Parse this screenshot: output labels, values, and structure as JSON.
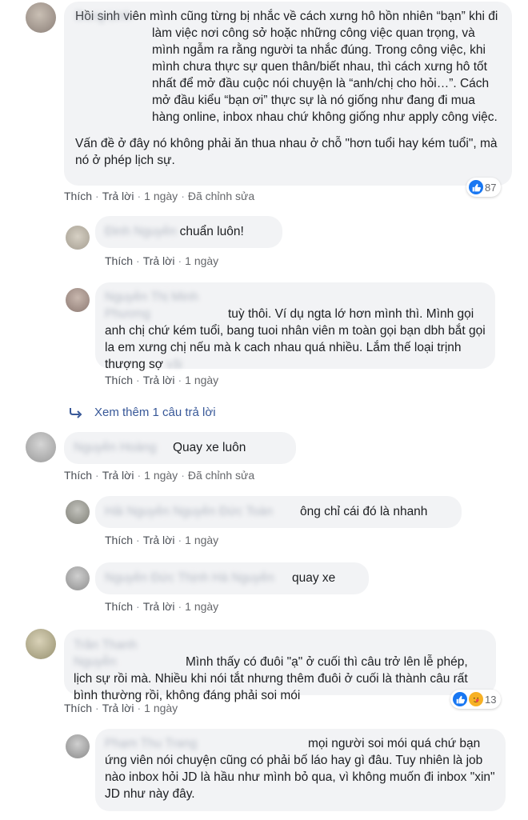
{
  "actions": {
    "like": "Thích",
    "reply": "Trả lời",
    "edited": "Đã chỉnh sửa",
    "dot": "·"
  },
  "comments": [
    {
      "name": "Dung Linh",
      "text": "Hồi sinh viên mình cũng từng bị nhắc về cách xưng hô hồn nhiên “bạn” khi đi làm việc nơi công sở hoặc những công việc quan trọng, và mình ngẫm ra rằng người ta nhắc đúng. Trong công việc, khi mình chưa thực sự quen thân/biết nhau, thì cách xưng hô tốt nhất để mở đầu cuộc nói chuyện là “anh/chị cho hỏi…”. Cách mở đầu kiểu “bạn ơi” thực sự là nó giống như đang đi mua hàng online, inbox nhau chứ không giống như apply công việc.",
      "text2": "Vấn đề ở đây nó không phải ăn thua nhau ở chỗ \"hơn tuổi hay kém tuổi\", mà nó ở phép lịch sự.",
      "time": "1 ngày",
      "reactions": "87"
    },
    {
      "name": "Đinh Nguyễn",
      "text": "chuẩn luôn!",
      "time": "1 ngày"
    },
    {
      "name": "Nguyễn Thị Minh Phương",
      "text": "tuỳ thôi. Ví dụ ngta lớ hơn mình thì. Mình gọi anh chị chứ kém tuổi, bang tuoi nhân viên m toàn gọi bạn dbh bắt gọi la em xưng chị nếu mà k cach nhau quá nhiều. Lắm thế loại trịnh thượng sợ",
      "tail": "vãi",
      "time": "1 ngày"
    },
    {
      "more": "Xem thêm 1 câu trả lời"
    },
    {
      "name": "Nguyễn Hoàng",
      "text": "Quay xe luôn",
      "time": "1 ngày"
    },
    {
      "name": "Hải Nguyễn Nguyễn Đức Toàn",
      "text": "ông chỉ cái đó là nhanh",
      "time": "1 ngày"
    },
    {
      "name": "Nguyễn Đức Thịnh Hà Nguyễn",
      "text": "quay xe",
      "time": "1 ngày"
    },
    {
      "name": "Trần Thanh Nguyễn",
      "text": "Mình thấy có đuôi \"ạ\" ở cuối thì câu trở lên lễ phép, lịch sự rồi mà. Nhiều khi nói tắt nhưng thêm đuôi ở cuối là thành câu rất bình thường rồi, không đáng phải soi mói",
      "time": "1 ngày",
      "reactions": "13"
    },
    {
      "name": "Phạm Thu Trang",
      "text": "mọi người soi mói quá chứ bạn ứng viên nói chuyện cũng có phải bố láo hay gì đâu. Tuy nhiên là job nào inbox hỏi JD là hầu như mình bỏ qua, vì không muốn đi inbox \"xin\" JD như này đây."
    }
  ],
  "colors": {
    "bubble": "#f2f3f5",
    "link": "#385898",
    "like": "#1877f2"
  }
}
